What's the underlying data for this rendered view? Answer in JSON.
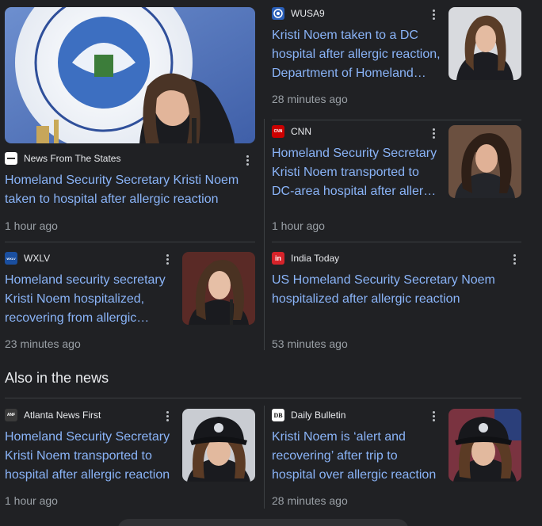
{
  "cards": [
    {
      "source": "News From The States",
      "headline": "Homeland Security Secretary Kristi Noem taken to hospital after allergic reaction",
      "time": "1 hour ago"
    },
    {
      "source": "WUSA9",
      "headline": "Kristi Noem taken to a DC hospital after allergic reaction, Department of Homeland Security says",
      "time": "28 minutes ago"
    },
    {
      "source": "CNN",
      "headline": "Homeland Security Secretary Kristi Noem transported to DC-area hospital after allergic reaction",
      "time": "1 hour ago"
    },
    {
      "source": "WXLV",
      "headline": "Homeland security secretary Kristi Noem hospitalized, recovering from allergic reaction",
      "time": "23 minutes ago"
    },
    {
      "source": "India Today",
      "headline": "US Homeland Security Secretary Noem hospitalized after allergic reaction",
      "time": "53 minutes ago"
    },
    {
      "source": "Atlanta News First",
      "headline": "Homeland Security Secretary Kristi Noem transported to hospital after allergic reaction",
      "time": "1 hour ago"
    },
    {
      "source": "Daily Bulletin",
      "headline": "Kristi Noem is ‘alert and recovering’ after trip to hospital over allergic reaction",
      "time": "28 minutes ago"
    }
  ],
  "section": {
    "title": "Also in the news"
  },
  "icons": {
    "wxlv": "WXLV",
    "cnn": "CNN",
    "india_today": "in",
    "anf": "ANF",
    "db": "DB"
  },
  "colors": {
    "background": "#202124",
    "link": "#8ab4f8",
    "meta": "#9aa0a6",
    "divider": "#3c4043"
  }
}
